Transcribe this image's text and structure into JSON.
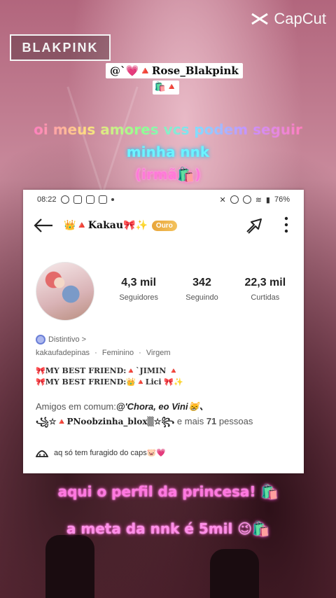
{
  "watermarks": {
    "group_logo": "BLAKPINK",
    "capcut": "CapCut"
  },
  "tag": {
    "handle": "@`💗🔺Rose_Blakpink",
    "sub": "🛍️🔺"
  },
  "captions": {
    "line1": "oi meus amores vcs podem seguir",
    "line2": "minha nnk",
    "line3": "(irmã🛍️)"
  },
  "phone": {
    "status": {
      "time": "08:22",
      "battery": "76%"
    },
    "profile": {
      "name": "👑🔺Kakau🎀✨",
      "badge": "Ouro",
      "stats": [
        {
          "value": "4,3 mil",
          "label": "Seguidores"
        },
        {
          "value": "342",
          "label": "Seguindo"
        },
        {
          "value": "22,3 mil",
          "label": "Curtidas"
        }
      ],
      "distintivo": "Distintivo >",
      "meta": [
        "kakaufadepinas",
        "·",
        "Feminino",
        "·",
        "Virgem"
      ],
      "best_friend_1": "🎀MY BEST FRIEND:🔺`JIMIN 🔺",
      "best_friend_2": "🎀MY BEST FRIEND:👑🔺Lici 🎀✨",
      "amigos_prefix": "Amigos em comum:",
      "amigos_names": "@'Chora, eo Vini😸、",
      "amigos_line2_name": "꧁☆🔺PNoobzinha_blox▒☆꧂",
      "amigos_line2_suffix_pre": "e mais",
      "amigos_line2_count": "71",
      "amigos_line2_suffix_post": "pessoas",
      "bio": "aq só tem furagido do caps🐷💗"
    }
  },
  "bottom": {
    "line1": "aqui o perfil da princesa! 🛍️",
    "line2": "a meta da nnk é 5mil 😉🛍️"
  }
}
